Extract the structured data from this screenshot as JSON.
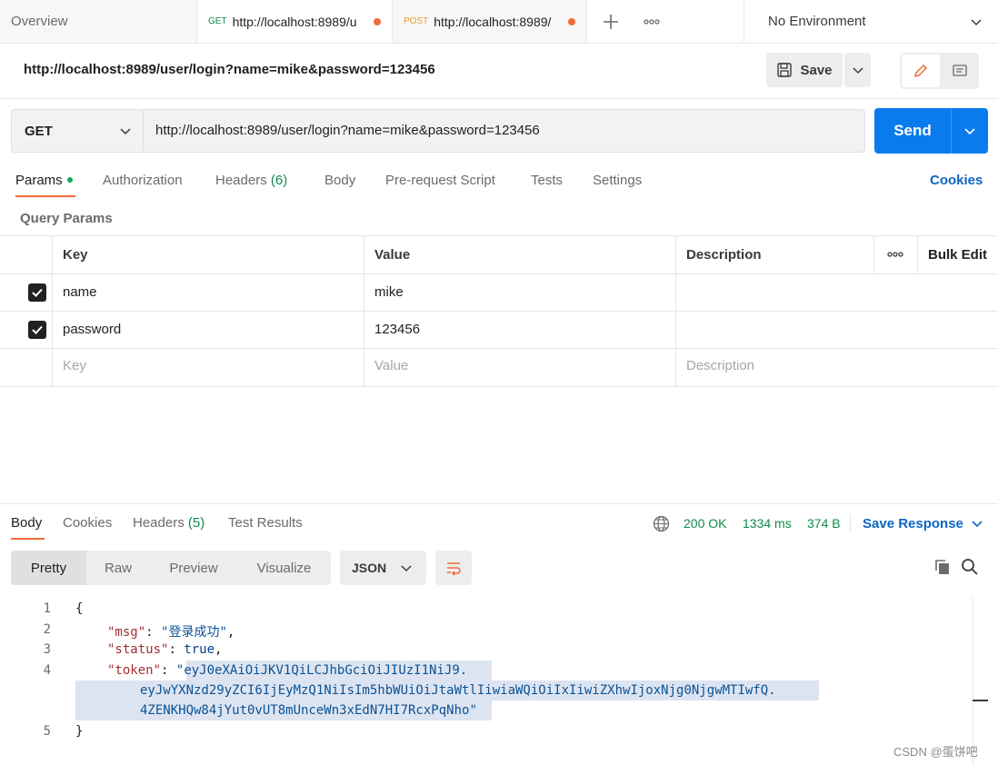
{
  "tabs": [
    {
      "label": "Overview"
    },
    {
      "method": "GET",
      "url": "http://localhost:8989/u"
    },
    {
      "method": "POST",
      "url": "http://localhost:8989/"
    }
  ],
  "environment": {
    "label": "No Environment"
  },
  "request_title": "http://localhost:8989/user/login?name=mike&password=123456",
  "save_label": "Save",
  "request": {
    "method": "GET",
    "url": "http://localhost:8989/user/login?name=mike&password=123456",
    "send_label": "Send"
  },
  "request_tabs": [
    {
      "label": "Params"
    },
    {
      "label": "Authorization"
    },
    {
      "label": "Headers",
      "count": "(6)"
    },
    {
      "label": "Body"
    },
    {
      "label": "Pre-request Script"
    },
    {
      "label": "Tests"
    },
    {
      "label": "Settings"
    }
  ],
  "cookies_label": "Cookies",
  "query_params": {
    "title": "Query Params",
    "headers": {
      "key": "Key",
      "value": "Value",
      "description": "Description",
      "bulk_edit": "Bulk Edit"
    },
    "rows": [
      {
        "key": "name",
        "value": "mike",
        "checked": true
      },
      {
        "key": "password",
        "value": "123456",
        "checked": true
      }
    ],
    "placeholder": {
      "key": "Key",
      "value": "Value",
      "description": "Description"
    }
  },
  "response_tabs": [
    {
      "label": "Body"
    },
    {
      "label": "Cookies"
    },
    {
      "label": "Headers",
      "count": "(5)"
    },
    {
      "label": "Test Results"
    }
  ],
  "response_status": {
    "status": "200 OK",
    "time": "1334 ms",
    "size": "374 B"
  },
  "save_response_label": "Save Response",
  "view_modes": [
    "Pretty",
    "Raw",
    "Preview",
    "Visualize"
  ],
  "format": "JSON",
  "code": {
    "line_numbers": [
      "1",
      "2",
      "3",
      "4",
      "5"
    ],
    "open_brace": "{",
    "close_brace": "}",
    "msg_key": "\"msg\"",
    "msg_val": "\"登录成功\"",
    "status_key": "\"status\"",
    "status_val": "true",
    "token_key": "\"token\"",
    "token_part1": "eyJ0eXAiOiJKV1QiLCJhbGciOiJIUzI1NiJ9.",
    "token_part2": "eyJwYXNzd29yZCI6IjEyMzQ1NiIsIm5hbWUiOiJtaWtlIiwiaWQiOiIxIiwiZXhwIjoxNjg0NjgwMTIwfQ.",
    "token_part3": "4ZENKHQw84jYut0vUT8mUnceWn3xEdN7HI7RcxPqNho"
  },
  "watermark": "CSDN @蛋饼吧",
  "colors": {
    "accent": "#f26b3a",
    "send": "#097bed",
    "status_ok": "#0f8a4d",
    "link_blue": "#0b66c3"
  }
}
